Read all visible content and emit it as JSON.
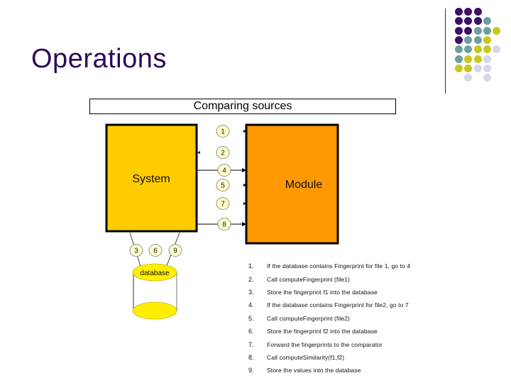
{
  "slide": {
    "title": "Operations",
    "caption": "Comparing sources"
  },
  "theme": {
    "title_color": "#2b0a5a",
    "dot_colors": {
      "purple": "#3d0f6b",
      "teal": "#6e9fa0",
      "yellow": "#c9c61f",
      "lavender": "#d6d6ea"
    },
    "system_fill": "#ffcc00",
    "module_fill": "#ff9900",
    "database_fill": "#ffee00",
    "step_badge_fill": "#ffffcc"
  },
  "decoration": {
    "dot_grid": [
      [
        "purple",
        "purple",
        "purple",
        "",
        ""
      ],
      [
        "purple",
        "purple",
        "purple",
        "teal",
        ""
      ],
      [
        "purple",
        "purple",
        "teal",
        "teal",
        "yellow"
      ],
      [
        "purple",
        "teal",
        "teal",
        "yellow",
        ""
      ],
      [
        "teal",
        "teal",
        "yellow",
        "yellow",
        "lavender"
      ],
      [
        "teal",
        "yellow",
        "yellow",
        "lavender",
        ""
      ],
      [
        "yellow",
        "yellow",
        "lavender",
        "lavender",
        ""
      ],
      [
        "",
        "lavender",
        "",
        "lavender",
        ""
      ]
    ]
  },
  "diagram": {
    "system_label": "System",
    "module_label": "Module",
    "database_label": "database",
    "badges_between": [
      "1",
      "2",
      "4",
      "5",
      "7",
      "8"
    ],
    "badges_database": [
      "3",
      "6",
      "9"
    ]
  },
  "steps": [
    {
      "num": "1.",
      "text": "If the database contains Fingerprint for file 1, go to 4"
    },
    {
      "num": "2.",
      "text": "Call computeFingerprint (file1)"
    },
    {
      "num": "3.",
      "text": "Store the fingerprint f1 into the database"
    },
    {
      "num": "4.",
      "text": "If the database contains Fingerprint for file2, go to 7"
    },
    {
      "num": "5.",
      "text": "Call computeFingerprint (file2)"
    },
    {
      "num": "6.",
      "text": "Store the fingerprint f2 into the database"
    },
    {
      "num": "7.",
      "text": "Forward the fingerprints to the comparator"
    },
    {
      "num": "8.",
      "text": "Call computeSimilarity(f1,f2)"
    },
    {
      "num": "9.",
      "text": "Store the values into the database"
    }
  ]
}
